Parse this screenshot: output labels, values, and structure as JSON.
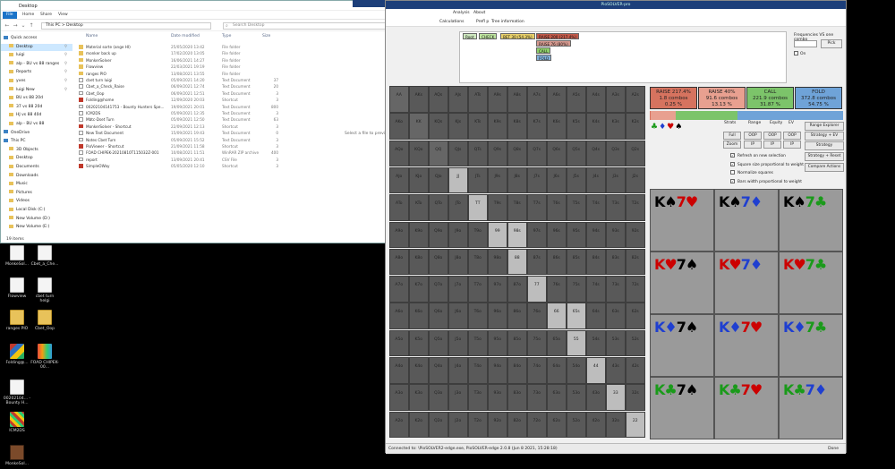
{
  "desktop": {
    "icons": [
      {
        "label": "MonkeSol...",
        "kind": "doc"
      },
      {
        "label": "Cbet_a_Che...",
        "kind": "doc"
      },
      {
        "label": "Flowview",
        "kind": "doc"
      },
      {
        "label": "cbet turn helgi",
        "kind": "doc"
      },
      {
        "label": "ranges PIO",
        "kind": "folder"
      },
      {
        "label": "Cbet_Oop",
        "kind": "folder"
      },
      {
        "label": "Folding@...",
        "kind": "fold"
      },
      {
        "label": "FOAD CHIPEK-00...",
        "kind": "pio"
      },
      {
        "label": "00202104... - Bounty H...",
        "kind": "doc"
      },
      {
        "label": "ICM2DS",
        "kind": "grid"
      },
      {
        "label": "MonkeSol...",
        "kind": "mk"
      }
    ]
  },
  "explorer": {
    "title": "Desktop",
    "ribbon": [
      "File",
      "Home",
      "Share",
      "View"
    ],
    "path": "This PC  >  Desktop",
    "search_placeholder": "Search Desktop",
    "nav": [
      {
        "label": "Quick access",
        "level": 0,
        "sel": false,
        "pin": false
      },
      {
        "label": "Desktop",
        "level": 1,
        "sel": true,
        "pin": true
      },
      {
        "label": "luigi",
        "level": 1,
        "sel": false,
        "pin": true
      },
      {
        "label": "alp - BU vs 88 ranges",
        "level": 1,
        "sel": false,
        "pin": true
      },
      {
        "label": "Reports",
        "level": 1,
        "sel": false,
        "pin": true
      },
      {
        "label": "yves",
        "level": 1,
        "sel": false,
        "pin": true
      },
      {
        "label": "luigi New",
        "level": 1,
        "sel": false,
        "pin": true
      },
      {
        "label": "BU vs 88 20d",
        "level": 1,
        "sel": false,
        "pin": false
      },
      {
        "label": "37 vs 88 20d",
        "level": 1,
        "sel": false,
        "pin": false
      },
      {
        "label": "HJ vs 88 40d",
        "level": 1,
        "sel": false,
        "pin": false
      },
      {
        "label": "alp - BU vs 88",
        "level": 1,
        "sel": false,
        "pin": false
      },
      {
        "label": "OneDrive",
        "level": 0,
        "sel": false,
        "pin": false
      },
      {
        "label": "This PC",
        "level": 0,
        "sel": false,
        "pin": false
      },
      {
        "label": "3D Objects",
        "level": 1,
        "sel": false,
        "pin": false
      },
      {
        "label": "Desktop",
        "level": 1,
        "sel": false,
        "pin": false
      },
      {
        "label": "Documents",
        "level": 1,
        "sel": false,
        "pin": false
      },
      {
        "label": "Downloads",
        "level": 1,
        "sel": false,
        "pin": false
      },
      {
        "label": "Music",
        "level": 1,
        "sel": false,
        "pin": false
      },
      {
        "label": "Pictures",
        "level": 1,
        "sel": false,
        "pin": false
      },
      {
        "label": "Videos",
        "level": 1,
        "sel": false,
        "pin": false
      },
      {
        "label": "Local Disk (C:)",
        "level": 1,
        "sel": false,
        "pin": false
      },
      {
        "label": "New Volume (D:)",
        "level": 1,
        "sel": false,
        "pin": false
      },
      {
        "label": "New Volume (E:)",
        "level": 1,
        "sel": false,
        "pin": false
      }
    ],
    "columns": [
      "Name",
      "Date modified",
      "Type",
      "Size"
    ],
    "files": [
      {
        "name": "Material sorte (ange HI)",
        "date": "25/05/2020 13:42",
        "type": "File folder",
        "size": "",
        "icon": "fld"
      },
      {
        "name": "monker back up",
        "date": "17/02/2020 13:05",
        "type": "File folder",
        "size": "",
        "icon": "fld"
      },
      {
        "name": "MonkerSolver",
        "date": "16/06/2021 14:27",
        "type": "File folder",
        "size": "",
        "icon": "fld"
      },
      {
        "name": "Flowview",
        "date": "22/03/2021 19:19",
        "type": "File folder",
        "size": "",
        "icon": "fld"
      },
      {
        "name": "ranges PIO",
        "date": "13/08/2021 13:55",
        "type": "File folder",
        "size": "",
        "icon": "fld"
      },
      {
        "name": "cbet turn luigi",
        "date": "05/09/2021 14:20",
        "type": "Text Document",
        "size": "37",
        "icon": "txt"
      },
      {
        "name": "Cbet_a_Check_Raise",
        "date": "06/09/2021 12:74",
        "type": "Text Document",
        "size": "20",
        "icon": "txt"
      },
      {
        "name": "Cbet_Oop",
        "date": "06/09/2021 12:51",
        "type": "Text Document",
        "size": "3",
        "icon": "txt"
      },
      {
        "name": "Folding@home",
        "date": "12/09/2020 20:03",
        "type": "Shortcut",
        "size": "3",
        "icon": "sc"
      },
      {
        "name": "00202104141753 - Bounty Hunters Spe...",
        "date": "19/09/2021 20:01",
        "type": "Text Document",
        "size": "800",
        "icon": "txt"
      },
      {
        "name": "ICM2DS",
        "date": "05/09/2021 12:35",
        "type": "Text Document",
        "size": "3",
        "icon": "txt"
      },
      {
        "name": "Mbtc-Dset Turn",
        "date": "05/09/2021 12:50",
        "type": "Text Document",
        "size": "63",
        "icon": "txt"
      },
      {
        "name": "MonkerSolver - Shortcut",
        "date": "22/09/2021 12:13",
        "type": "Shortcut",
        "size": "3",
        "icon": "sc"
      },
      {
        "name": "New Text Document",
        "date": "15/09/2021 19:43",
        "type": "Text Document",
        "size": "0",
        "icon": "txt"
      },
      {
        "name": "Notes Cbet Turn",
        "date": "05/09/2021 15:52",
        "type": "Text Document",
        "size": "3",
        "icon": "txt"
      },
      {
        "name": "PioViewer - Shortcut",
        "date": "21/09/2021 11:58",
        "type": "Shortcut",
        "size": "3",
        "icon": "sc"
      },
      {
        "name": "FOAD CHIPEK-20210810T115032Z-001",
        "date": "10/08/2021 11:51",
        "type": "WinRAR ZIP archive",
        "size": "400",
        "icon": "txt"
      },
      {
        "name": "report",
        "date": "13/09/2021 20:41",
        "type": "CSV File",
        "size": "3",
        "icon": "txt"
      },
      {
        "name": "SimpleOWay",
        "date": "05/05/2020 12:10",
        "type": "Shortcut",
        "size": "3",
        "icon": "sc"
      }
    ],
    "preview_msg": "Select a file to preview.",
    "status": "19 items"
  },
  "pio": {
    "title": "PioSOLVER-pro",
    "menu": [
      "Analysis",
      "About"
    ],
    "submenu": [
      "Calculations",
      "Prefl p",
      "Tree information"
    ],
    "tree_nodes": [
      {
        "label": "Root",
        "color": "#cfe9c0"
      },
      {
        "label": "CHECK",
        "color": "#bfe6a0"
      },
      {
        "label": "BET 30 (54.3%)",
        "color": "#e8d06a"
      },
      {
        "label": "RAISE 200 (217.4%)",
        "color": "#c25a4a"
      },
      {
        "label": "RAISE 76 (80%)",
        "color": "#d79a90"
      },
      {
        "label": "CALL",
        "color": "#8fd06a"
      },
      {
        "label": "FOLD",
        "color": "#80b0d8"
      }
    ],
    "freq_label": "Frequencies VS one combo",
    "pick_label": "Pick",
    "on_label": "On",
    "grid_ranks": [
      "A",
      "K",
      "Q",
      "J",
      "T",
      "9",
      "8",
      "7",
      "6",
      "5",
      "4",
      "3",
      "2"
    ],
    "actions": [
      {
        "title": "RAISE 217.4%",
        "combos": "1.8 combos",
        "pct": "0.25 %",
        "color": "#d6735f"
      },
      {
        "title": "RAISE 40%",
        "combos": "91.6 combos",
        "pct": "13.13 %",
        "color": "#e8a090"
      },
      {
        "title": "CALL",
        "combos": "221.9 combos",
        "pct": "31.87 %",
        "color": "#7cc46a"
      },
      {
        "title": "FOLD",
        "combos": "372.8 combos",
        "pct": "54.75 %",
        "color": "#6fa3d8"
      }
    ],
    "rangebar": [
      {
        "color": "#d6735f",
        "pct": 0.25
      },
      {
        "color": "#e8a090",
        "pct": 13.13
      },
      {
        "color": "#7cc46a",
        "pct": 31.87
      },
      {
        "color": "#6fa3d8",
        "pct": 54.75
      }
    ],
    "calc_tabs": [
      "Strats",
      "Range",
      "Equity",
      "EV"
    ],
    "pos_buttons": [
      "Full",
      "OOP",
      "OOP",
      "OOP",
      "Zoom",
      "IP",
      "IP",
      "IP"
    ],
    "side_buttons": [
      "Range Explorer",
      "Strategy + EV",
      "Strategy",
      "Strategy + Reset",
      "Compare Actions"
    ],
    "checks": [
      {
        "label": "Refresh on new selection",
        "on": true
      },
      {
        "label": "Square size proportional to weight",
        "on": true
      },
      {
        "label": "Normalize squares",
        "on": false
      },
      {
        "label": "Bars width proportional to weight",
        "on": true
      }
    ],
    "combos": [
      {
        "rank1": "K",
        "suit1": "♠",
        "c1": "#000",
        "rank2": "7",
        "suit2": "♥",
        "c2": "#cc0000"
      },
      {
        "rank1": "K",
        "suit1": "♠",
        "c1": "#000",
        "rank2": "7",
        "suit2": "♦",
        "c2": "#1f3fd0"
      },
      {
        "rank1": "K",
        "suit1": "♠",
        "c1": "#000",
        "rank2": "7",
        "suit2": "♣",
        "c2": "#1a9a1a"
      },
      {
        "rank1": "K",
        "suit1": "♥",
        "c1": "#cc0000",
        "rank2": "7",
        "suit2": "♠",
        "c2": "#000"
      },
      {
        "rank1": "K",
        "suit1": "♥",
        "c1": "#cc0000",
        "rank2": "7",
        "suit2": "♦",
        "c2": "#1f3fd0"
      },
      {
        "rank1": "K",
        "suit1": "♥",
        "c1": "#cc0000",
        "rank2": "7",
        "suit2": "♣",
        "c2": "#1a9a1a"
      },
      {
        "rank1": "K",
        "suit1": "♦",
        "c1": "#1f3fd0",
        "rank2": "7",
        "suit2": "♠",
        "c2": "#000"
      },
      {
        "rank1": "K",
        "suit1": "♦",
        "c1": "#1f3fd0",
        "rank2": "7",
        "suit2": "♥",
        "c2": "#cc0000"
      },
      {
        "rank1": "K",
        "suit1": "♦",
        "c1": "#1f3fd0",
        "rank2": "7",
        "suit2": "♣",
        "c2": "#1a9a1a"
      },
      {
        "rank1": "K",
        "suit1": "♣",
        "c1": "#1a9a1a",
        "rank2": "7",
        "suit2": "♠",
        "c2": "#000"
      },
      {
        "rank1": "K",
        "suit1": "♣",
        "c1": "#1a9a1a",
        "rank2": "7",
        "suit2": "♥",
        "c2": "#cc0000"
      },
      {
        "rank1": "K",
        "suit1": "♣",
        "c1": "#1a9a1a",
        "rank2": "7",
        "suit2": "♦",
        "c2": "#1f3fd0"
      }
    ],
    "status": "Connected to: \\PioSOLVER2-edge.exe, PioSOLVER-edge 2.0.8 (Jun 8 2021, 15:28:18)",
    "status_right": "Done"
  }
}
